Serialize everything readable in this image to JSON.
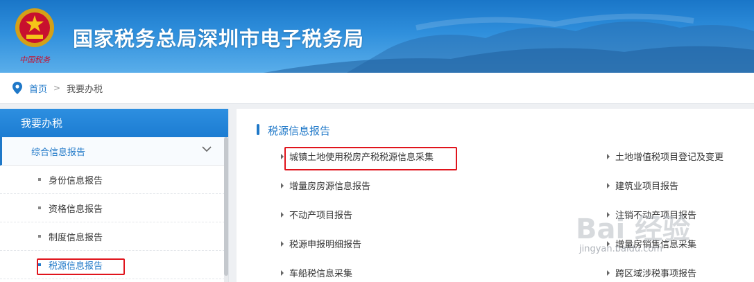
{
  "banner": {
    "title": "国家税务总局深圳市电子税务局",
    "emblem_caption": "中国税务"
  },
  "breadcrumb": {
    "home": "首页",
    "separator": ">",
    "current": "我要办税"
  },
  "sidebar": {
    "header": "我要办税",
    "group": "综合信息报告",
    "items": [
      {
        "label": "身份信息报告"
      },
      {
        "label": "资格信息报告"
      },
      {
        "label": "制度信息报告"
      },
      {
        "label": "税源信息报告",
        "active": true
      }
    ]
  },
  "main": {
    "section_title": "税源信息报告",
    "left_links": [
      "城镇土地使用税房产税税源信息采集",
      "增量房房源信息报告",
      "不动产项目报告",
      "税源申报明细报告",
      "车船税信息采集"
    ],
    "right_links": [
      "土地增值税项目登记及变更",
      "建筑业项目报告",
      "注销不动产项目报告",
      "增量房销售信息采集",
      "跨区域涉税事项报告"
    ]
  },
  "watermark": {
    "logo_text": "Bai 经验",
    "url": "jingyan.baidu.com"
  },
  "colors": {
    "accent": "#1f78c8",
    "highlight": "#e0141c",
    "banner": "#2f8fdc"
  }
}
